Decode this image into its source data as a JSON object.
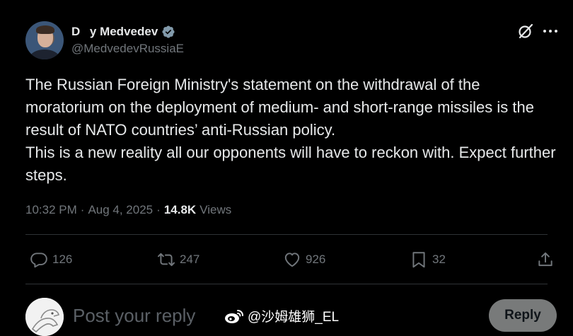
{
  "colors": {
    "background": "#000000",
    "primary_text": "#e7e9ea",
    "secondary_text": "#71767b",
    "verified_badge": "#829aab",
    "reply_button_bg": "#787a7a",
    "divider": "#2f3336"
  },
  "author": {
    "display_name": "D    y Medvedev",
    "handle": "@MedvedevRussiaE",
    "verified": true
  },
  "tweet": {
    "paragraph_1": "The Russian Foreign Ministry's statement on the withdrawal of the moratorium on the deployment of medium- and short-range missiles is the result of NATO countries’ anti-Russian policy.",
    "paragraph_2": "This is a new reality all our opponents will have to reckon with. Expect further steps."
  },
  "meta": {
    "time": "10:32 PM",
    "separator": "·",
    "date": "Aug 4, 2025",
    "views_count": "14.8K",
    "views_label": "Views"
  },
  "actions": {
    "reply_count": "126",
    "repost_count": "247",
    "like_count": "926",
    "bookmark_count": "32"
  },
  "icons": {
    "verified": "verified-badge-icon",
    "grok": "grok-icon",
    "more": "more-icon",
    "reply": "reply-icon",
    "repost": "repost-icon",
    "like": "heart-icon",
    "bookmark": "bookmark-icon",
    "share": "share-icon"
  },
  "composer": {
    "placeholder": "Post your reply",
    "reply_button": "Reply"
  },
  "watermark": {
    "text": "@沙姆雄狮_EL"
  }
}
